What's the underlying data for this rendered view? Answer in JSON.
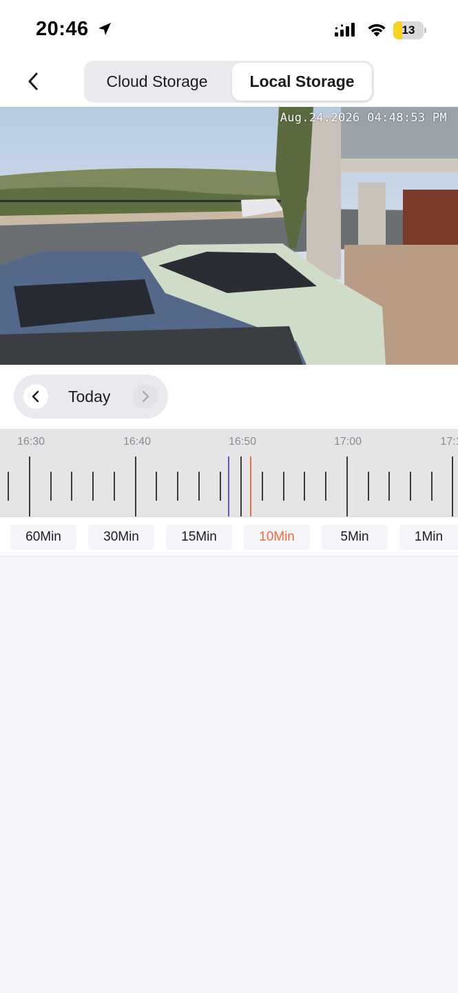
{
  "status_bar": {
    "time": "20:46",
    "battery_level": "13",
    "battery_fraction": 0.3
  },
  "header": {
    "tabs": [
      {
        "label": "Cloud Storage",
        "selected": false
      },
      {
        "label": "Local Storage",
        "selected": true
      }
    ]
  },
  "video": {
    "timestamp": "Aug.24.2026 04:48:53 PM"
  },
  "date_nav": {
    "label": "Today"
  },
  "timeline": {
    "labels": [
      "16:30",
      "16:40",
      "16:50",
      "17:00",
      "17:1"
    ]
  },
  "zoom": {
    "options": [
      "60Min",
      "30Min",
      "15Min",
      "10Min",
      "5Min",
      "1Min"
    ],
    "selected": "10Min",
    "accent_color": "#f26b3a"
  },
  "icons": {
    "back": "chevron-left-icon",
    "location": "location-arrow-icon",
    "signal": "cellular-signal-icon",
    "wifi": "wifi-icon",
    "date_prev": "chevron-left-icon",
    "date_next": "chevron-right-icon"
  }
}
